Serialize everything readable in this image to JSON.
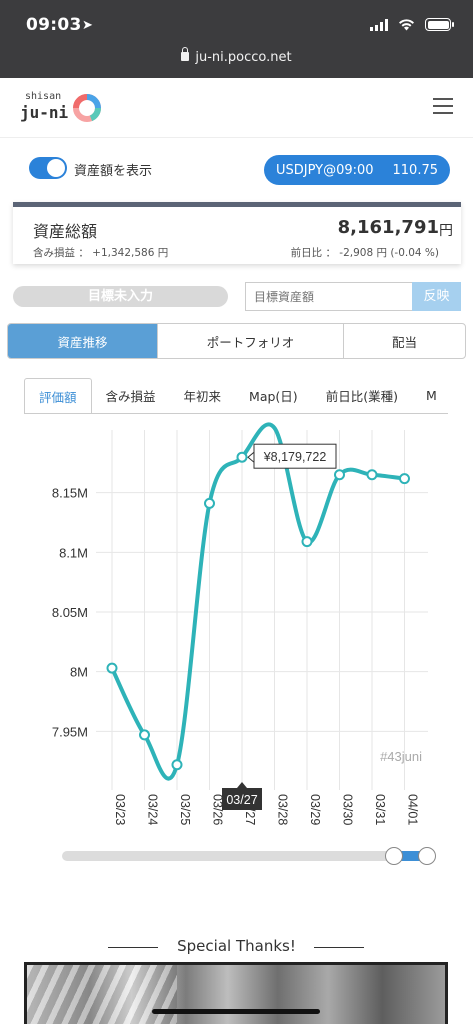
{
  "status_bar": {
    "time": "09:03",
    "url": "ju-ni.pocco.net"
  },
  "header": {
    "logo_small": "shisan",
    "logo_main": "ju-ni"
  },
  "display_toggle": {
    "label": "資産額を表示",
    "on": true
  },
  "fx": {
    "pair": "USDJPY@09:00",
    "rate": "110.75"
  },
  "total": {
    "label": "資産総額",
    "value": "8,161,791",
    "unit": "円",
    "unrealized": "含み損益 ： +1,342,586 円",
    "day_change": "前日比 ： -2,908 円 (-0.04 %)"
  },
  "goal": {
    "status": "目標未入力",
    "placeholder": "目標資産額",
    "apply_label": "反映"
  },
  "main_tabs": [
    {
      "label": "資産推移",
      "active": true
    },
    {
      "label": "ポートフォリオ",
      "active": false
    },
    {
      "label": "配当",
      "active": false
    }
  ],
  "sub_tabs": [
    {
      "label": "評価額",
      "active": true
    },
    {
      "label": "含み損益",
      "active": false
    },
    {
      "label": "年初来",
      "active": false
    },
    {
      "label": "Map(日)",
      "active": false
    },
    {
      "label": "前日比(業種)",
      "active": false
    },
    {
      "label": "M",
      "active": false
    }
  ],
  "chart_data": {
    "type": "line",
    "categories": [
      "03/23",
      "03/24",
      "03/25",
      "03/26",
      "03/27",
      "03/28",
      "03/29",
      "03/30",
      "03/31",
      "04/01"
    ],
    "values": [
      8003000,
      7947000,
      7922000,
      8141000,
      8179722,
      null,
      8109000,
      8165000,
      8165000,
      8161791
    ],
    "y_ticks": [
      "7.95M",
      "8M",
      "8.05M",
      "8.1M",
      "8.15M"
    ],
    "ylim": [
      7900000,
      8200000
    ],
    "grid": true,
    "line_color": "#2eb3b8",
    "tooltip": "¥8,179,722",
    "highlight_label": "03/27",
    "watermark": "#43juni"
  },
  "footer": {
    "thanks": "Special Thanks!"
  }
}
